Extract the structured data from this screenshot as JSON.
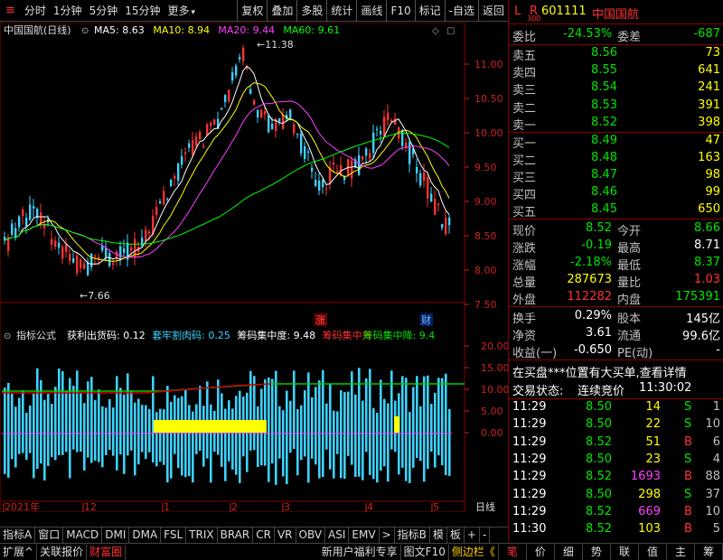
{
  "toolbar": {
    "periods": [
      "分时",
      "1分钟",
      "5分钟",
      "15分钟",
      "更多"
    ],
    "actions": [
      "复权",
      "叠加",
      "多股",
      "统计",
      "画线",
      "F10",
      "标记",
      "-自选",
      "返回"
    ]
  },
  "chart": {
    "title": "中国国航(日线)",
    "ma": [
      {
        "label": "MA5: 8.63",
        "color": "#ffffff"
      },
      {
        "label": "MA10: 8.94",
        "color": "#ffff00"
      },
      {
        "label": "MA20: 9.44",
        "color": "#ff40ff"
      },
      {
        "label": "MA60: 9.61",
        "color": "#00ff00"
      }
    ],
    "price_axis": [
      "11.00",
      "10.50",
      "10.00",
      "9.50",
      "9.00",
      "8.50",
      "8.00",
      "7.50"
    ],
    "high_label": "11.38",
    "low_label": "7.66",
    "marker_zhang": "涨",
    "marker_cai": "财",
    "indicator_title": "指标公式",
    "indicator_items": [
      {
        "label": "获利出货码: 0.12",
        "color": "#ffffff"
      },
      {
        "label": "套牢割肉码: 0.25",
        "color": "#3cd2ff"
      },
      {
        "label": "筹码集中度: 9.48",
        "color": "#ffffff"
      },
      {
        "label": "筹码集中升",
        "color": "#ff3232"
      },
      {
        "label": "筹码集中降: 9.4",
        "color": "#00e600"
      }
    ],
    "ind_axis": [
      "20.00",
      "15.00",
      "10.00",
      "5.00",
      "0.00"
    ],
    "date_axis": [
      "2021年",
      "12",
      "1",
      "2",
      "3",
      "4",
      "5"
    ],
    "date_right": "日线"
  },
  "indicator_tabs": [
    "指标A",
    "窗口",
    "MACD",
    "DMI",
    "DMA",
    "FSL",
    "TRIX",
    "BRAR",
    "CR",
    "VR",
    "OBV",
    "ASI",
    "EMV",
    ">",
    "指标B",
    "模",
    "板",
    "+",
    "-"
  ],
  "bottom_tabs": [
    "扩展^",
    "关联报价",
    "财富圈"
  ],
  "bottom_right": [
    "新用户福利专享",
    "图文F10",
    "侧边栏《"
  ],
  "bottom_side": [
    "笔",
    "价",
    "细",
    "势",
    "联",
    "值",
    "主",
    "筹"
  ],
  "quote": {
    "code": "601111",
    "name": "中国国航",
    "lr": "L",
    "r": "R",
    "r_sub": "300",
    "weibi_label": "委比",
    "weibi": "-24.53%",
    "weicha_label": "委差",
    "weicha": "-687",
    "asks": [
      {
        "label": "卖五",
        "price": "8.56",
        "vol": "73"
      },
      {
        "label": "卖四",
        "price": "8.55",
        "vol": "641"
      },
      {
        "label": "卖三",
        "price": "8.54",
        "vol": "241"
      },
      {
        "label": "卖二",
        "price": "8.53",
        "vol": "391"
      },
      {
        "label": "卖一",
        "price": "8.52",
        "vol": "398"
      }
    ],
    "bids": [
      {
        "label": "买一",
        "price": "8.49",
        "vol": "47"
      },
      {
        "label": "买二",
        "price": "8.48",
        "vol": "163"
      },
      {
        "label": "买三",
        "price": "8.47",
        "vol": "98"
      },
      {
        "label": "买四",
        "price": "8.46",
        "vol": "99"
      },
      {
        "label": "买五",
        "price": "8.45",
        "vol": "650"
      }
    ],
    "stats": [
      {
        "l1": "现价",
        "v1": "8.52",
        "c1": "green",
        "l2": "今开",
        "v2": "8.66",
        "c2": "green"
      },
      {
        "l1": "涨跌",
        "v1": "-0.19",
        "c1": "green",
        "l2": "最高",
        "v2": "8.71",
        "c2": "white"
      },
      {
        "l1": "涨幅",
        "v1": "-2.18%",
        "c1": "green",
        "l2": "最低",
        "v2": "8.37",
        "c2": "green"
      },
      {
        "l1": "总量",
        "v1": "287673",
        "c1": "yellow",
        "l2": "量比",
        "v2": "1.03",
        "c2": "red"
      },
      {
        "l1": "外盘",
        "v1": "112282",
        "c1": "red",
        "l2": "内盘",
        "v2": "175391",
        "c2": "green"
      }
    ],
    "stats2": [
      {
        "l1": "换手",
        "v1": "0.29%",
        "l2": "股本",
        "v2": "145亿"
      },
      {
        "l1": "净资",
        "v1": "3.61",
        "l2": "流通",
        "v2": "99.6亿"
      },
      {
        "l1": "收益(一)",
        "v1": "-0.650",
        "l2": "PE(动)",
        "v2": "-"
      }
    ],
    "notice": "在买盘***位置有大买单,查看详情",
    "status_label": "交易状态:",
    "status_value": "连续竞价",
    "status_time": "11:30:02",
    "ticks": [
      {
        "time": "11:29",
        "price": "8.50",
        "vol": "14",
        "vcolor": "yellow",
        "side": "S",
        "scolor": "green",
        "n": "1"
      },
      {
        "time": "11:29",
        "price": "8.50",
        "vol": "22",
        "vcolor": "yellow",
        "side": "S",
        "scolor": "green",
        "n": "10"
      },
      {
        "time": "11:29",
        "price": "8.52",
        "vol": "51",
        "vcolor": "yellow",
        "side": "B",
        "scolor": "red",
        "n": "6"
      },
      {
        "time": "11:29",
        "price": "8.50",
        "vol": "23",
        "vcolor": "yellow",
        "side": "S",
        "scolor": "green",
        "n": "4"
      },
      {
        "time": "11:29",
        "price": "8.52",
        "vol": "1693",
        "vcolor": "magenta",
        "side": "B",
        "scolor": "red",
        "n": "88"
      },
      {
        "time": "11:29",
        "price": "8.50",
        "vol": "298",
        "vcolor": "yellow",
        "side": "S",
        "scolor": "green",
        "n": "37"
      },
      {
        "time": "11:29",
        "price": "8.52",
        "vol": "669",
        "vcolor": "magenta",
        "side": "B",
        "scolor": "red",
        "n": "10"
      },
      {
        "time": "11:30",
        "price": "8.52",
        "vol": "103",
        "vcolor": "yellow",
        "side": "B",
        "scolor": "red",
        "n": "5"
      }
    ]
  }
}
